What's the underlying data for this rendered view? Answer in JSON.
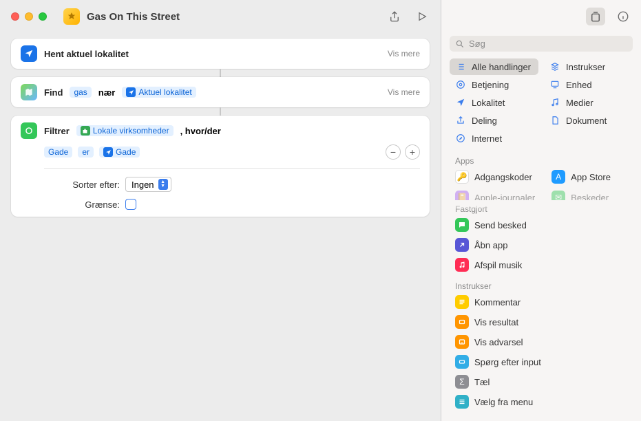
{
  "window": {
    "title": "Gas On This Street"
  },
  "actions": {
    "a1": {
      "title": "Hent aktuel lokalitet",
      "show_more": "Vis mere"
    },
    "a2": {
      "prefix": "Find",
      "query": "gas",
      "near": "nær",
      "var": "Aktuel lokalitet",
      "show_more": "Vis mere"
    },
    "a3": {
      "prefix": "Filtrer",
      "var": "Lokale virksomheder",
      "suffix": ", hvor/der",
      "filter_field": "Gade",
      "filter_op": "er",
      "filter_val": "Gade",
      "sort_label": "Sorter efter:",
      "sort_value": "Ingen",
      "limit_label": "Grænse:"
    }
  },
  "sidebar": {
    "search_placeholder": "Søg",
    "categories": [
      {
        "label": "Alle handlinger",
        "color": "#3b7ded",
        "icon": "list"
      },
      {
        "label": "Instrukser",
        "color": "#3b7ded",
        "icon": "stack"
      },
      {
        "label": "Betjening",
        "color": "#3b7ded",
        "icon": "remote"
      },
      {
        "label": "Enhed",
        "color": "#3b7ded",
        "icon": "device"
      },
      {
        "label": "Lokalitet",
        "color": "#3b7ded",
        "icon": "nav"
      },
      {
        "label": "Medier",
        "color": "#3b7ded",
        "icon": "music"
      },
      {
        "label": "Deling",
        "color": "#3b7ded",
        "icon": "share"
      },
      {
        "label": "Dokument",
        "color": "#3b7ded",
        "icon": "doc"
      },
      {
        "label": "Internet",
        "color": "#3b7ded",
        "icon": "safari"
      }
    ],
    "apps_label": "Apps",
    "apps": [
      {
        "label": "Adgangskoder",
        "color": "#ffffff",
        "icon": "key"
      },
      {
        "label": "App Store",
        "color": "#1f9bff",
        "icon": "A"
      },
      {
        "label": "Apple-journaler",
        "color": "#a55ef0",
        "icon": "book"
      },
      {
        "label": "Beskeder",
        "color": "#34c759",
        "icon": "msg"
      }
    ],
    "pinned_label": "Fastgjort",
    "pinned": [
      {
        "label": "Send besked",
        "color": "#34c759",
        "icon": "msg"
      },
      {
        "label": "Åbn app",
        "color": "#5856d6",
        "icon": "open"
      },
      {
        "label": "Afspil musik",
        "color": "#ff2d55",
        "icon": "music"
      }
    ],
    "instr_label": "Instrukser",
    "instr": [
      {
        "label": "Kommentar",
        "color": "#ffcc00",
        "icon": "lines"
      },
      {
        "label": "Vis resultat",
        "color": "#ff9500",
        "icon": "eye"
      },
      {
        "label": "Vis advarsel",
        "color": "#ff9500",
        "icon": "alert"
      },
      {
        "label": "Spørg efter input",
        "color": "#32ade6",
        "icon": "input"
      },
      {
        "label": "Tæl",
        "color": "#8e8e93",
        "icon": "sigma"
      },
      {
        "label": "Vælg fra menu",
        "color": "#30b0c7",
        "icon": "menu"
      }
    ]
  }
}
